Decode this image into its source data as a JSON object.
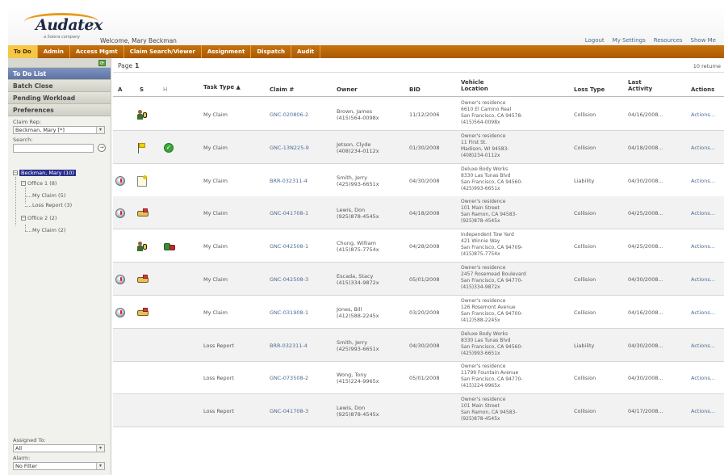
{
  "header": {
    "logo_text": "Audatex",
    "logo_tagline": "a Solera company",
    "welcome": "Welcome, Mary Beckman",
    "links": [
      "Logout",
      "My Settings",
      "Resources",
      "Show Me"
    ]
  },
  "nav": {
    "tabs": [
      "To Do",
      "Admin",
      "Access Mgmt",
      "Claim Search/Viewer",
      "Assignment",
      "Dispatch",
      "Audit"
    ],
    "active_tab": "To Do"
  },
  "sidebar": {
    "sections": [
      "To Do List",
      "Batch Close",
      "Pending Workload",
      "Preferences"
    ],
    "active_section": "To Do List",
    "claim_rep_label": "Claim Rep:",
    "claim_rep_value": "Beckman, Mary [*]",
    "search_label": "Search:",
    "search_value": "",
    "tree": {
      "root": "Beckman, Mary (10)",
      "office1": "Office 1 (8)",
      "office1_children": [
        "My Claim (5)",
        "Loss Report (3)"
      ],
      "office2": "Office 2 (2)",
      "office2_children": [
        "My Claim (2)"
      ]
    },
    "assigned_to_label": "Assigned To:",
    "assigned_to_value": "All",
    "alarm_label": "Alarm:",
    "alarm_value": "No Filter"
  },
  "main": {
    "page_label": "Page",
    "page_number": "1",
    "returned_text": "10 returne",
    "columns": {
      "a": "A",
      "s": "S",
      "h": "H",
      "task_type": "Task Type ▲",
      "claim": "Claim #",
      "owner": "Owner",
      "bid": "BID",
      "vehicle_location_1": "Vehicle",
      "vehicle_location_2": "Location",
      "loss_type": "Loss Type",
      "last_activity_1": "Last",
      "last_activity_2": "Activity",
      "actions": "Actions"
    },
    "rows": [
      {
        "a_icon": "",
        "s_icon": "person-key-icon",
        "h_icon": "",
        "task": "My Claim",
        "claim": "GNC-020806-2",
        "owner1": "Brown, James",
        "owner2": "(415)564-0098x",
        "bid": "11/12/2006",
        "loc": [
          "Owner's residence",
          "6610 El Camino Real",
          "San Francisco, CA 94578-",
          "(415)564-0098x"
        ],
        "loss": "Collision",
        "last": "04/16/2008...",
        "actions": "Actions..."
      },
      {
        "a_icon": "",
        "s_icon": "flag-icon",
        "h_icon": "check-icon",
        "task": "My Claim",
        "claim": "GNC-13N225-9",
        "owner1": "Jetson, Clyde",
        "owner2": "(408)234-0112x",
        "bid": "01/30/2008",
        "loc": [
          "Owner's residence",
          "11 First St.",
          "Madison, WI 94583-",
          "(408)234-0112x"
        ],
        "loss": "Collision",
        "last": "04/18/2008...",
        "actions": "Actions..."
      },
      {
        "a_icon": "alarm-icon",
        "s_icon": "note-icon",
        "h_icon": "",
        "task": "My Claim",
        "claim": "BRR-032311-4",
        "owner1": "Smith, Jerry",
        "owner2": "(425)993-6651x",
        "bid": "04/30/2008",
        "loc": [
          "Deluxe Body Works",
          "8330 Las Tunas Blvd",
          "San Francisco, CA 94560-",
          "(425)993-6651x"
        ],
        "loss": "Liability",
        "last": "04/30/2008...",
        "actions": "Actions..."
      },
      {
        "a_icon": "alarm-icon",
        "s_icon": "car-icon",
        "h_icon": "",
        "task": "My Claim",
        "claim": "GNC-041708-1",
        "owner1": "Lewis, Don",
        "owner2": "(925)878-4545x",
        "bid": "04/18/2008",
        "loc": [
          "Owner's residence",
          "101 Main Street",
          "San Ramon, CA 94583-",
          "(925)878-4545x"
        ],
        "loss": "Collision",
        "last": "04/25/2008...",
        "actions": "Actions..."
      },
      {
        "a_icon": "",
        "s_icon": "person-key-icon",
        "h_icon": "tow-icon",
        "task": "My Claim",
        "claim": "GNC-042508-1",
        "owner1": "Chung, William",
        "owner2": "(415)875-7754x",
        "bid": "04/28/2008",
        "loc": [
          "Independent Tow Yard",
          "421 Winnie Way",
          "San Francisco, CA 94709-",
          "(415)875-7754x"
        ],
        "loss": "Collision",
        "last": "04/25/2008...",
        "actions": "Actions..."
      },
      {
        "a_icon": "alarm-icon",
        "s_icon": "car-icon",
        "h_icon": "",
        "task": "My Claim",
        "claim": "GNC-042508-3",
        "owner1": "Escada, Stacy",
        "owner2": "(415)334-9872x",
        "bid": "05/01/2008",
        "loc": [
          "Owner's residence",
          "2457 Rosemead Boulevard",
          "San Francisco, CA 94770-",
          "(415)334-9872x"
        ],
        "loss": "Collision",
        "last": "04/30/2008...",
        "actions": "Actions..."
      },
      {
        "a_icon": "alarm-icon",
        "s_icon": "car-icon",
        "h_icon": "",
        "task": "My Claim",
        "claim": "GNC-031908-1",
        "owner1": "Jones, Bill",
        "owner2": "(412)588-2245x",
        "bid": "03/20/2008",
        "loc": [
          "Owner's residence",
          "126 Rosemont Avenue",
          "San Francisco, CA 94700-",
          "(412)588-2245x"
        ],
        "loss": "Collision",
        "last": "04/16/2008...",
        "actions": "Actions..."
      },
      {
        "a_icon": "",
        "s_icon": "",
        "h_icon": "",
        "task": "Loss Report",
        "claim": "BRR-032311-4",
        "owner1": "Smith, Jerry",
        "owner2": "(425)993-6651x",
        "bid": "04/30/2008",
        "loc": [
          "Deluxe Body Works",
          "8330 Las Tunas Blvd",
          "San Francisco, CA 94560-",
          "(425)993-6651x"
        ],
        "loss": "Liability",
        "last": "04/30/2008...",
        "actions": "Actions..."
      },
      {
        "a_icon": "",
        "s_icon": "",
        "h_icon": "",
        "task": "Loss Report",
        "claim": "GNC-073508-2",
        "owner1": "Wong, Tony",
        "owner2": "(415)224-9965x",
        "bid": "05/01/2008",
        "loc": [
          "Owner's residence",
          "11799 Fountain Avenue",
          "San Francisco, CA 94770-",
          "(415)224-9965x"
        ],
        "loss": "Collision",
        "last": "04/30/2008...",
        "actions": "Actions..."
      },
      {
        "a_icon": "",
        "s_icon": "",
        "h_icon": "",
        "task": "Loss Report",
        "claim": "GNC-041708-3",
        "owner1": "Lewis, Don",
        "owner2": "(925)878-4545x",
        "bid": "",
        "loc": [
          "Owner's residence",
          "101 Main Street",
          "San Ramon, CA 94583-",
          "(925)878-4545x"
        ],
        "loss": "Collision",
        "last": "04/17/2008...",
        "actions": "Actions..."
      }
    ]
  }
}
